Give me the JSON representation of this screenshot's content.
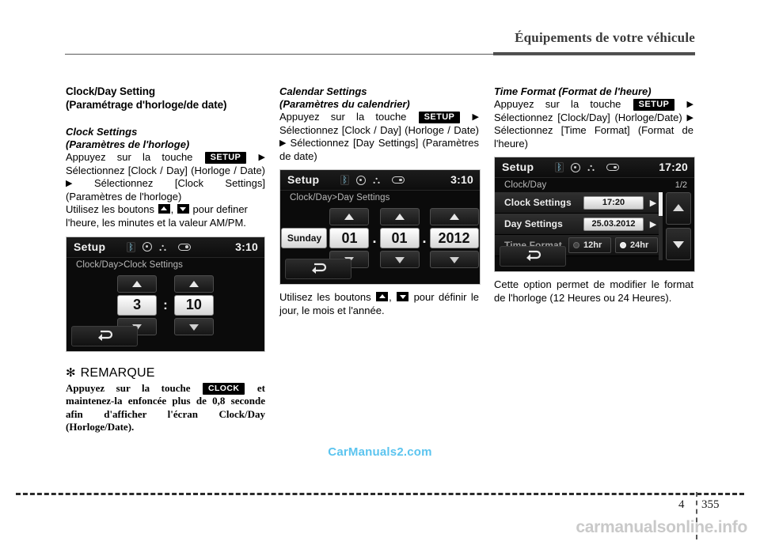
{
  "header": {
    "title": "Équipements de votre véhicule"
  },
  "footer": {
    "chapter": "4",
    "page": "355",
    "watermark_center": "CarManuals2.com",
    "watermark_bottom": "carmanualsonline.info"
  },
  "col1": {
    "section_title_line1": "Clock/Day Setting",
    "section_title_line2": "(Paramétrage d'horloge/de date)",
    "sub_title_line1": "Clock Settings",
    "sub_title_line2": "(Paramètres de l'horloge)",
    "para_a1": "Appuyez sur la touche",
    "keycap_setup": "SETUP",
    "para_a2": "Sélectionnez [Clock / Day] (Horloge / Date)",
    "para_a3": "Sélectionnez [Clock Settings] (Paramètres de l'horloge)",
    "para_b1": "Utilisez les boutons",
    "para_b2": ",",
    "para_b3": "pour definer l'heure, les minutes et la valeur AM/PM.",
    "screen": {
      "title": "Setup",
      "clock": "3:10",
      "breadcrumb": "Clock/Day>Clock Settings",
      "hour": "3",
      "colon": ":",
      "minute": "10"
    },
    "remarque": {
      "star": "✻",
      "title": "REMARQUE",
      "body_1": "Appuyez sur la touche",
      "keycap_clock": "CLOCK",
      "body_2": "et maintenez-la enfoncée plus de 0,8 seconde afin d'afficher l'écran Clock/Day (Horloge/Date)."
    }
  },
  "col2": {
    "sub_title_line1": "Calendar Settings",
    "sub_title_line2": "(Paramètres du calendrier)",
    "para_a1": "Appuyez sur la touche",
    "keycap_setup": "SETUP",
    "para_a2": "Sélectionnez [Clock / Day] (Horloge / Date)",
    "para_a3": "Sélectionnez [Day Settings] (Paramètres de date)",
    "screen": {
      "title": "Setup",
      "clock": "3:10",
      "breadcrumb": "Clock/Day>Day Settings",
      "weekday": "Sunday",
      "day": "01",
      "sep1": ".",
      "month": "01",
      "sep2": ".",
      "year": "2012"
    },
    "para_b1": "Utilisez les boutons",
    "para_b2": ",",
    "para_b3": "pour définir le jour, le mois et l'année."
  },
  "col3": {
    "sub_title": "Time Format (Format de l'heure)",
    "para_a1": "Appuyez sur la touche",
    "keycap_setup": "SETUP",
    "para_a2": "Sélectionnez [Clock/Day] (Horloge/Date)",
    "para_a3": "Sélectionnez [Time Format] (Format de l'heure)",
    "screen": {
      "title": "Setup",
      "clock": "17:20",
      "breadcrumb": "Clock/Day",
      "page_indicator": "1/2",
      "rows": [
        {
          "label": "Clock Settings",
          "value": "17:20",
          "caret": "▶"
        },
        {
          "label": "Day Settings",
          "value": "25.03.2012",
          "caret": "▶"
        }
      ],
      "time_format_label": "Time Format",
      "opt_12hr": "12hr",
      "opt_24hr": "24hr"
    },
    "para_b": "Cette option permet de modifier le format de l'horloge (12 Heures ou 24 Heures)."
  },
  "icons": {
    "bluetooth": "bluetooth-icon",
    "disc": "disc-icon",
    "usb": "usb-icon",
    "aux": "aux-icon",
    "back": "back-arrow-icon"
  },
  "colors": {
    "watermark_blue": "#5bc4ef",
    "lcd_background": "#0b0b0b",
    "text": "#000000"
  }
}
